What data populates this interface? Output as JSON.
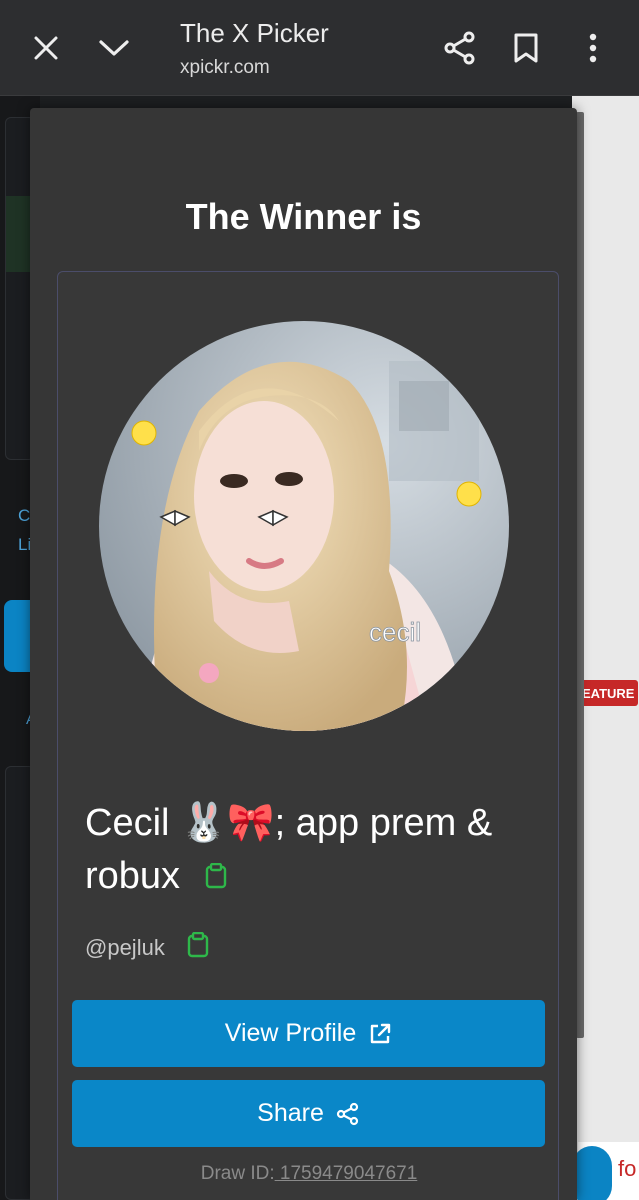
{
  "browser": {
    "title": "The X Picker",
    "url": "xpickr.com",
    "icons": [
      "close-icon",
      "chevron-down-icon",
      "share-icon",
      "bookmark-icon",
      "more-vert-icon"
    ]
  },
  "background": {
    "text1": "C",
    "text2": "Li",
    "text3": "A",
    "badge": "EATURE",
    "fab_text": "fo"
  },
  "dialog": {
    "heading": "The Winner is",
    "winner_name": "Cecil 🐰🎀; app prem & robux",
    "winner_handle": "@pejluk",
    "avatar_sticker_text": "cecil",
    "view_profile_label": "View Profile",
    "share_label": "Share",
    "draw_id_label": "Draw ID:",
    "draw_id_value": " 1759479047671"
  },
  "colors": {
    "accent": "#0a87c8",
    "copy_icon": "#2eb84a",
    "dialog_bg": "#363636",
    "badge": "#c62828"
  }
}
